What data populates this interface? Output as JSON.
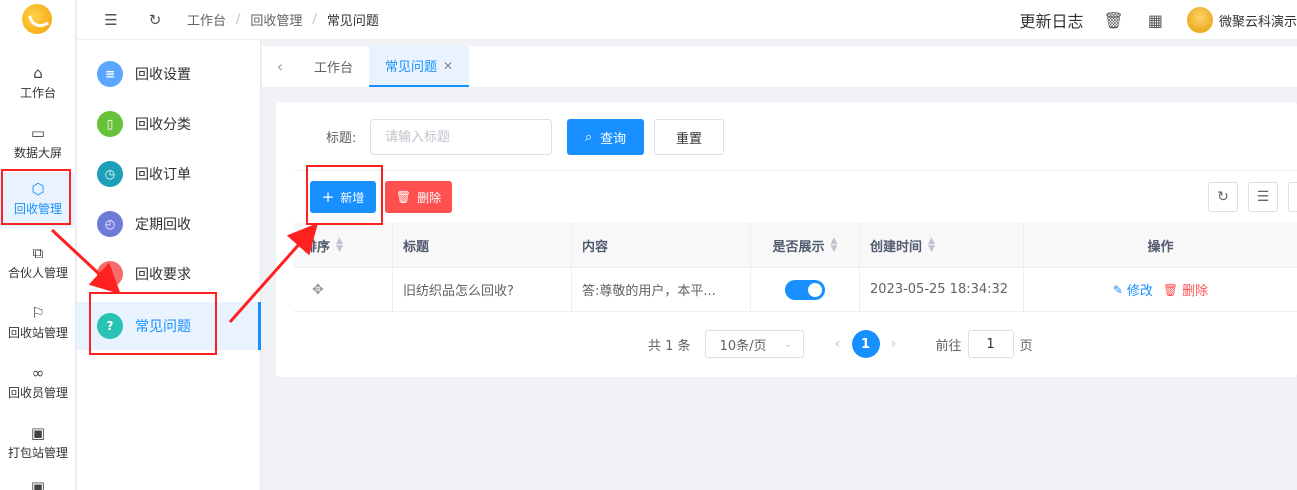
{
  "rail": {
    "items": [
      {
        "label": "工作台",
        "icon": "home-icon"
      },
      {
        "label": "数据大屏",
        "icon": "screen-icon"
      },
      {
        "label": "回收管理",
        "icon": "cube-icon"
      },
      {
        "label": "合伙人管理",
        "icon": "partner-icon"
      },
      {
        "label": "回收站管理",
        "icon": "flag-icon"
      },
      {
        "label": "回收员管理",
        "icon": "infinity-icon"
      },
      {
        "label": "打包站管理",
        "icon": "box-icon"
      }
    ]
  },
  "submenu": {
    "items": [
      {
        "label": "回收设置",
        "color": "#5ba7ff",
        "glyph": "≡"
      },
      {
        "label": "回收分类",
        "color": "#67c23a",
        "glyph": "▯"
      },
      {
        "label": "回收订单",
        "color": "#1e9fb8",
        "glyph": "◷"
      },
      {
        "label": "定期回收",
        "color": "#6f7bd9",
        "glyph": "◴"
      },
      {
        "label": "回收要求",
        "color": "#f56c6c",
        "glyph": "!"
      },
      {
        "label": "常见问题",
        "color": "#29c3b4",
        "glyph": "?"
      }
    ]
  },
  "header": {
    "breadcrumbs": [
      "工作台",
      "回收管理",
      "常见问题"
    ],
    "changelog": "更新日志",
    "user": "微聚云科演示"
  },
  "tabs": [
    {
      "label": "工作台"
    },
    {
      "label": "常见问题"
    }
  ],
  "search": {
    "label": "标题:",
    "placeholder": "请输入标题",
    "query": "查询",
    "reset": "重置"
  },
  "toolbar": {
    "add": "新增",
    "delete": "删除"
  },
  "table": {
    "columns": [
      "排序",
      "标题",
      "内容",
      "是否展示",
      "创建时间",
      "操作"
    ],
    "rows": [
      {
        "title": "旧纺织品怎么回收?",
        "content": "答:尊敬的用户，本平...",
        "show": true,
        "created": "2023-05-25 18:34:32",
        "edit": "修改",
        "delete": "删除"
      }
    ]
  },
  "pager": {
    "total": "共 1 条",
    "size": "10条/页",
    "current": "1",
    "goto_prefix": "前往",
    "goto_value": "1",
    "goto_suffix": "页"
  },
  "colors": {
    "primary": "#1890ff",
    "danger": "#ff5050",
    "annotation": "#ff2020"
  }
}
